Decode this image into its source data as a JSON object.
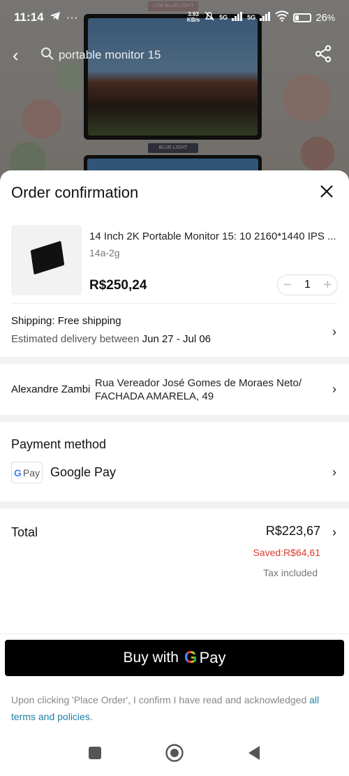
{
  "status_bar": {
    "time": "11:14",
    "net_speed_top": "3.93",
    "net_speed_bottom": "KB/s",
    "sig1": "5G",
    "sig2": "5G",
    "battery": "26"
  },
  "background": {
    "search_text": "portable monitor 15",
    "logo_top": "LOW BLUE LIGHT",
    "logo_bottom": "BLUE LIGHT"
  },
  "sheet": {
    "title": "Order confirmation",
    "product": {
      "title": "14 Inch 2K Portable Monitor 15: 10 2160*1440 IPS ...",
      "variant": "14a-2g",
      "price": "R$250,24",
      "quantity": "1"
    },
    "shipping": {
      "label": "Shipping: Free shipping",
      "estimate_prefix": "Estimated delivery between ",
      "estimate_dates": "Jun 27 - Jul 06"
    },
    "address": {
      "name": "Alexandre Zambi",
      "line": "Rua Vereador José Gomes de Moraes Neto/ FACHADA AMARELA, 49"
    },
    "payment": {
      "title": "Payment method",
      "badge_g": "G",
      "badge_pay": "Pay",
      "method": "Google Pay"
    },
    "total": {
      "label": "Total",
      "amount": "R$223,67",
      "saved": "Saved:R$64,61",
      "tax": "Tax included"
    },
    "buy_button": {
      "prefix": "Buy with",
      "g": "G",
      "pay": "Pay"
    },
    "terms": {
      "text": "Upon clicking 'Place Order', I confirm I have read and acknowledged ",
      "link": "all terms and policies."
    }
  },
  "colors": {
    "saved_red": "#e0392b",
    "link_blue": "#1d7fa8",
    "button_black": "#000000"
  }
}
